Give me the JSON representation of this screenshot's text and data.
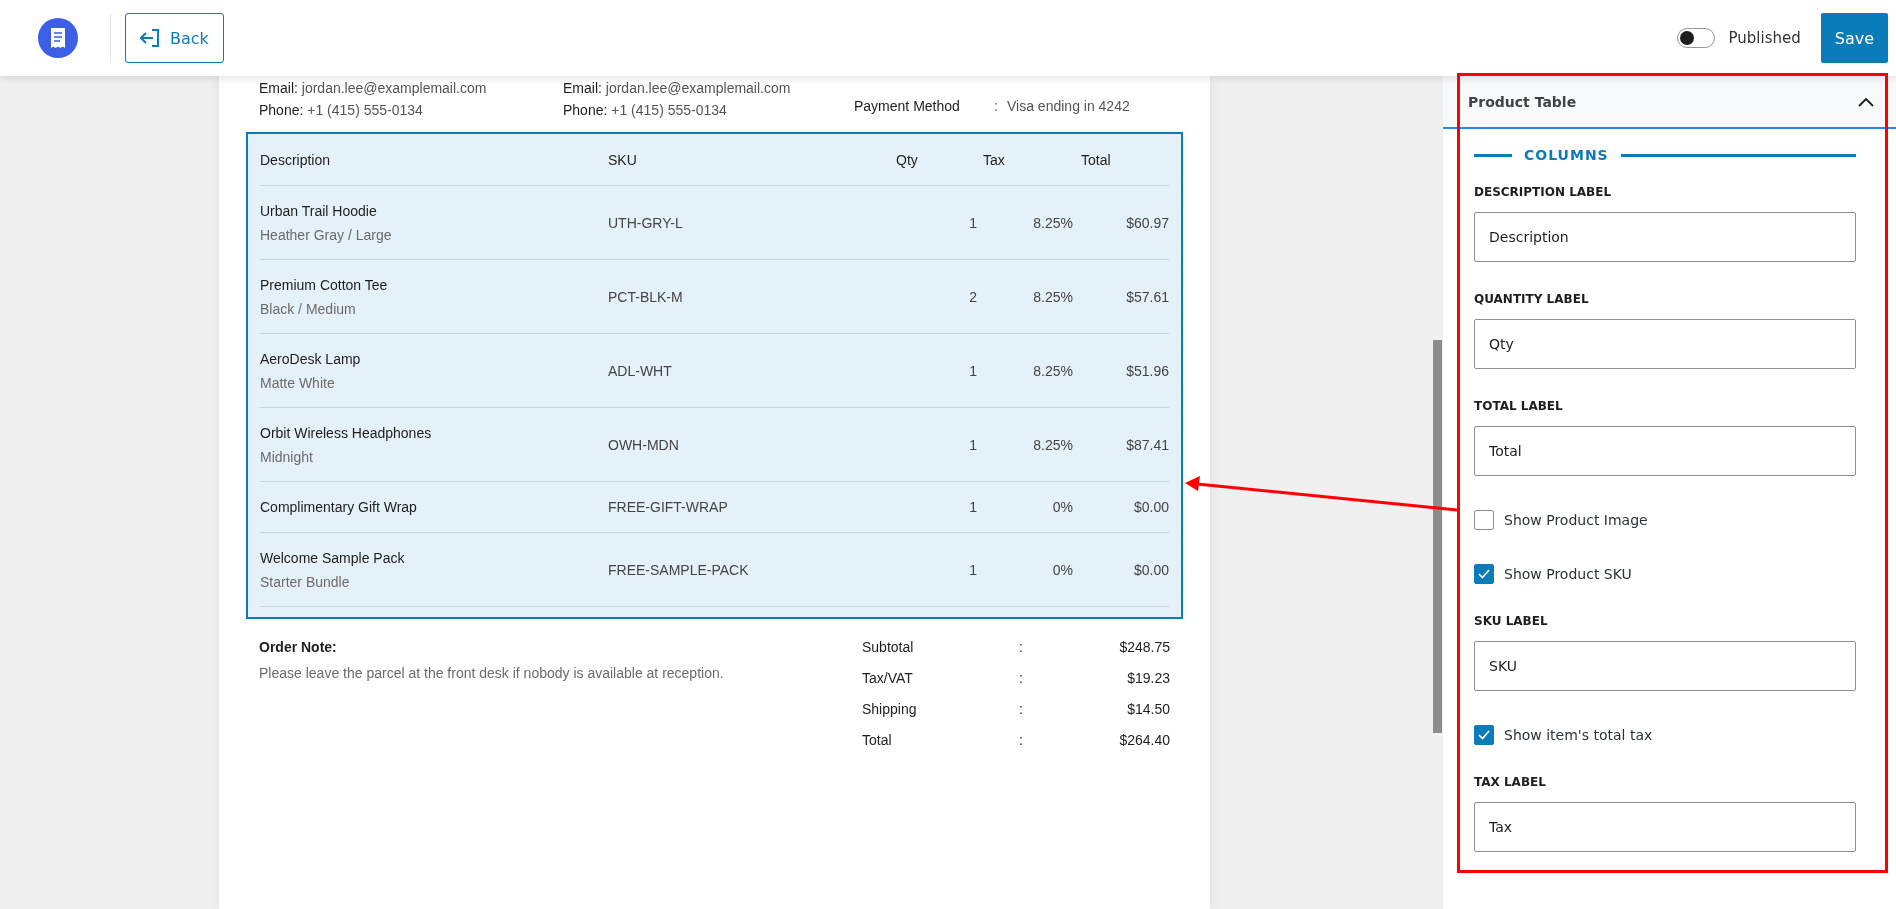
{
  "header": {
    "back_label": "Back",
    "published": {
      "label": "Published",
      "on": false
    },
    "save_label": "Save"
  },
  "document": {
    "contacts": [
      {
        "email_label": "Email:",
        "email": "jordan.lee@examplemail.com",
        "phone_label": "Phone:",
        "phone": "+1 (415) 555-0134"
      },
      {
        "email_label": "Email:",
        "email": "jordan.lee@examplemail.com",
        "phone_label": "Phone:",
        "phone": "+1 (415) 555-0134"
      }
    ],
    "payment": {
      "label": "Payment Method",
      "separator": ":",
      "value": "Visa ending in 4242"
    },
    "table": {
      "columns": [
        "Description",
        "SKU",
        "Qty",
        "Tax",
        "Total"
      ],
      "rows": [
        {
          "name": "Urban Trail Hoodie",
          "variant": "Heather Gray / Large",
          "sku": "UTH-GRY-L",
          "qty": "1",
          "tax": "8.25%",
          "total": "$60.97"
        },
        {
          "name": "Premium Cotton Tee",
          "variant": "Black / Medium",
          "sku": "PCT-BLK-M",
          "qty": "2",
          "tax": "8.25%",
          "total": "$57.61"
        },
        {
          "name": "AeroDesk Lamp",
          "variant": "Matte White",
          "sku": "ADL-WHT",
          "qty": "1",
          "tax": "8.25%",
          "total": "$51.96"
        },
        {
          "name": "Orbit Wireless Headphones",
          "variant": "Midnight",
          "sku": "OWH-MDN",
          "qty": "1",
          "tax": "8.25%",
          "total": "$87.41"
        },
        {
          "name": "Complimentary Gift Wrap",
          "sku": "FREE-GIFT-WRAP",
          "qty": "1",
          "tax": "0%",
          "total": "$0.00"
        },
        {
          "name": "Welcome Sample Pack",
          "variant": "Starter Bundle",
          "sku": "FREE-SAMPLE-PACK",
          "qty": "1",
          "tax": "0%",
          "total": "$0.00"
        }
      ]
    },
    "note": {
      "title": "Order Note:",
      "text": "Please leave the parcel at the front desk if nobody is available at reception."
    },
    "totals": [
      {
        "label": "Subtotal",
        "separator": ":",
        "value": "$248.75"
      },
      {
        "label": "Tax/VAT",
        "separator": ":",
        "value": "$19.23"
      },
      {
        "label": "Shipping",
        "separator": ":",
        "value": "$14.50"
      },
      {
        "label": "Total",
        "separator": ":",
        "value": "$264.40"
      }
    ]
  },
  "panel": {
    "title": "Product Table",
    "expanded": true,
    "section": "COLUMNS",
    "controls": [
      {
        "kind": "field",
        "label": "DESCRIPTION LABEL",
        "value": "Description"
      },
      {
        "kind": "field",
        "label": "QUANTITY LABEL",
        "value": "Qty"
      },
      {
        "kind": "field",
        "label": "TOTAL LABEL",
        "value": "Total"
      },
      {
        "kind": "checkbox",
        "label": "Show Product Image",
        "checked": false
      },
      {
        "kind": "checkbox",
        "label": "Show Product SKU",
        "checked": true
      },
      {
        "kind": "field",
        "label": "SKU LABEL",
        "value": "SKU"
      },
      {
        "kind": "checkbox",
        "label": "Show item's total tax",
        "checked": true
      },
      {
        "kind": "field",
        "label": "TAX LABEL",
        "value": "Tax"
      }
    ]
  }
}
